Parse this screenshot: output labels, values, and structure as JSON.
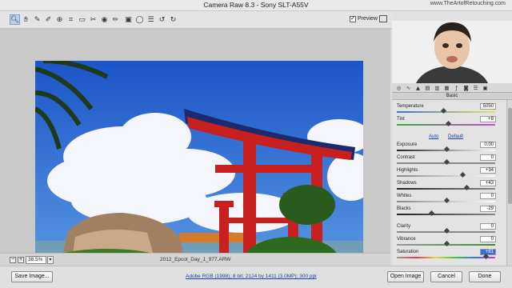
{
  "window": {
    "title": "Camera Raw 8.3  -  Sony SLT-A55V",
    "watermark": "www.TheArtofRetouching.com"
  },
  "toolbar": {
    "tools": [
      "zoom-tool-icon",
      "hand-tool-icon",
      "white-balance-icon",
      "color-sampler-icon",
      "targeted-adjustment-icon",
      "crop-icon",
      "straighten-icon",
      "spot-removal-icon",
      "red-eye-icon",
      "adjustment-brush-icon",
      "graduated-filter-icon",
      "radial-filter-icon",
      "preferences-icon",
      "rotate-ccw-icon",
      "rotate-cw-icon"
    ],
    "preview_label": "Preview",
    "preview_checked": "✓"
  },
  "status": {
    "zoom": "38.5%",
    "filename": "2012_Epcot_Day_1_977.ARW"
  },
  "bottom": {
    "save_image": "Save Image...",
    "workflow": "Adobe RGB (1998); 8 bit; 2124 by 1411 (3.0MP); 300 ppi",
    "open_image": "Open Image",
    "cancel": "Cancel",
    "done": "Done"
  },
  "panel": {
    "header": "Basic",
    "auto": "Auto",
    "default": "Default",
    "sliders": [
      {
        "label": "Temperature",
        "value": "5050",
        "pos": 0.47,
        "gradient": "linear-gradient(90deg,#3e6fd8,#e9e16a)"
      },
      {
        "label": "Tint",
        "value": "+8",
        "pos": 0.52,
        "gradient": "linear-gradient(90deg,#3aa845,#c84fc8)"
      },
      {
        "label": "Exposure",
        "value": "0.00",
        "pos": 0.5,
        "gradient": "linear-gradient(90deg,#222,#fff)"
      },
      {
        "label": "Contrast",
        "value": "0",
        "pos": 0.5,
        "gradient": "linear-gradient(90deg,#888,#888)"
      },
      {
        "label": "Highlights",
        "value": "+34",
        "pos": 0.67,
        "gradient": "linear-gradient(90deg,#888,#fff)"
      },
      {
        "label": "Shadows",
        "value": "+43",
        "pos": 0.71,
        "gradient": "linear-gradient(90deg,#222,#888)"
      },
      {
        "label": "Whites",
        "value": "0",
        "pos": 0.5,
        "gradient": "linear-gradient(90deg,#888,#fff)"
      },
      {
        "label": "Blacks",
        "value": "-29",
        "pos": 0.35,
        "gradient": "linear-gradient(90deg,#222,#888)"
      },
      {
        "label": "Clarity",
        "value": "0",
        "pos": 0.5,
        "gradient": "linear-gradient(90deg,#888,#888)"
      },
      {
        "label": "Vibrance",
        "value": "0",
        "pos": 0.5,
        "gradient": "linear-gradient(90deg,#999,#3c8a3c)"
      },
      {
        "label": "Saturation",
        "value": "+81",
        "pos": 0.9,
        "gradient": "linear-gradient(90deg,#999,#e63a3a,#e6d23a,#3ac83a,#3a6fe6,#c83ac8)"
      }
    ]
  },
  "panel_tabs": [
    "aperture-icon",
    "tone-curve-icon",
    "detail-icon",
    "hsl-icon",
    "split-tone-icon",
    "lens-icon",
    "fx-icon",
    "camera-calibration-icon",
    "presets-icon",
    "snapshots-icon"
  ]
}
